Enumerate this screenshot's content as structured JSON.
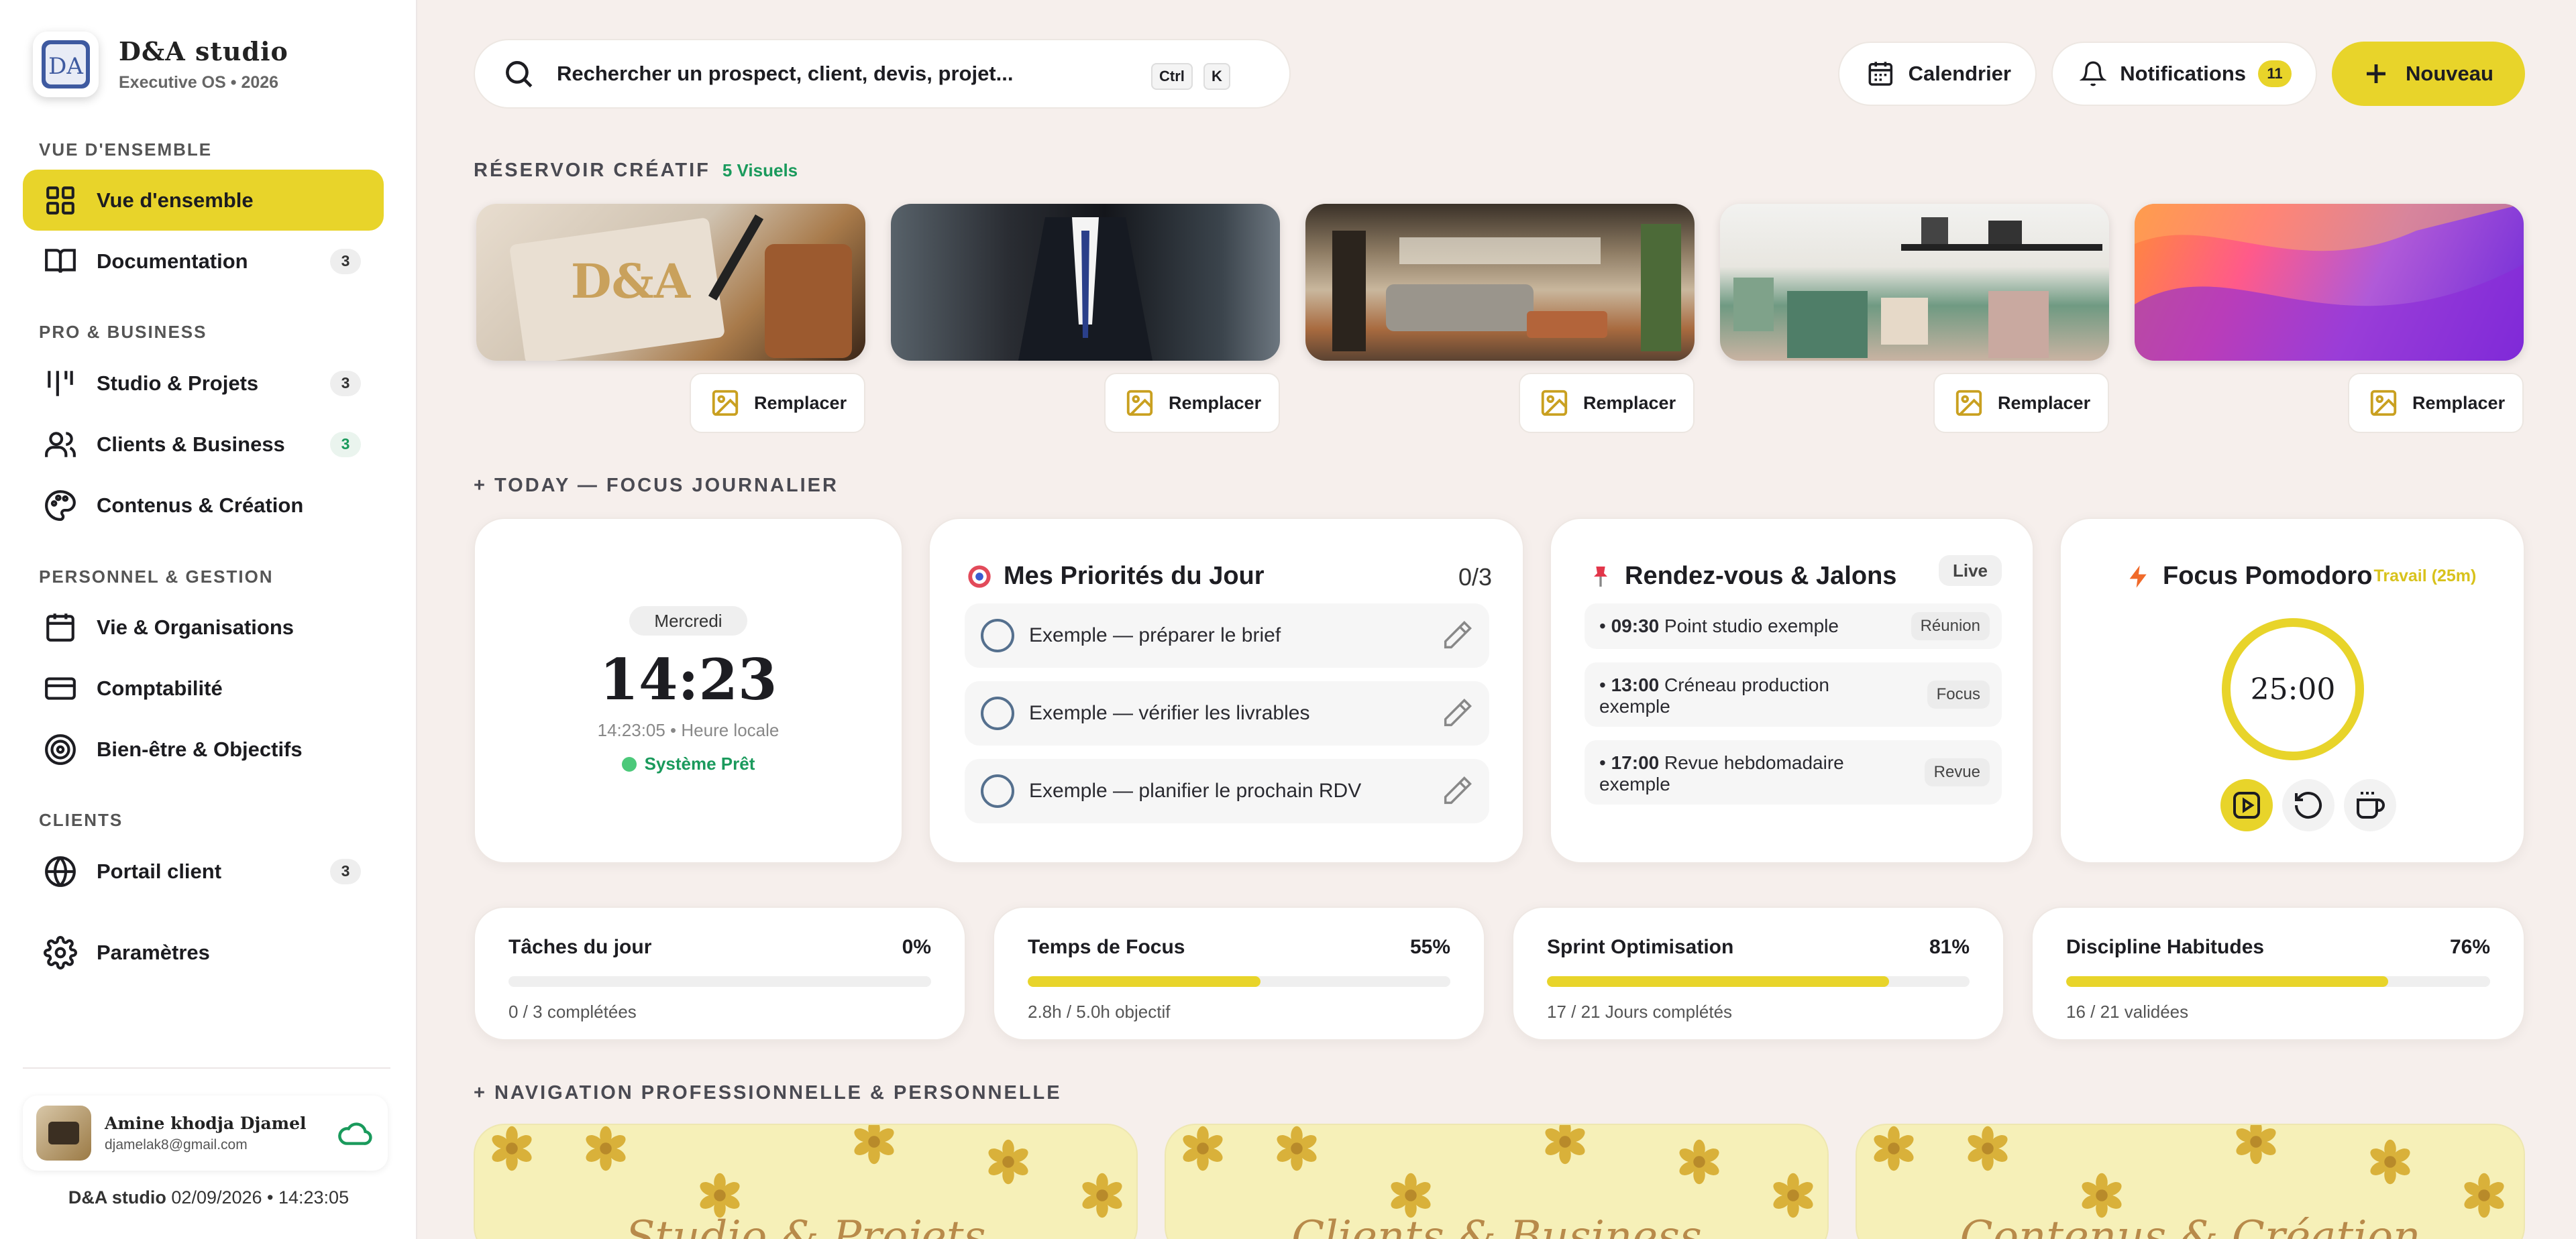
{
  "brand": {
    "name": "D&A studio",
    "subtitle": "Executive OS • 2026"
  },
  "sidebar": {
    "sections": [
      {
        "title": "VUE D'ENSEMBLE"
      },
      {
        "title": "PRO & BUSINESS"
      },
      {
        "title": "PERSONNEL & GESTION"
      },
      {
        "title": "CLIENTS"
      }
    ],
    "items": [
      {
        "label": "Vue d'ensemble",
        "icon": "grid-icon",
        "active": true
      },
      {
        "label": "Documentation",
        "icon": "book-icon",
        "badge": "3"
      },
      {
        "label": "Studio & Projets",
        "icon": "bars-icon",
        "badge": "3"
      },
      {
        "label": "Clients & Business",
        "icon": "users-icon",
        "badge": "3"
      },
      {
        "label": "Contenus & Création",
        "icon": "palette-icon"
      },
      {
        "label": "Vie & Organisations",
        "icon": "calendar-icon"
      },
      {
        "label": "Comptabilité",
        "icon": "card-icon"
      },
      {
        "label": "Bien-être & Objectifs",
        "icon": "target-icon"
      },
      {
        "label": "Portail client",
        "icon": "globe-icon",
        "badge": "3"
      },
      {
        "label": "Paramètres",
        "icon": "gear-icon"
      }
    ],
    "user": {
      "name": "Amine khodja Djamel",
      "email": "djamelak8@gmail.com"
    },
    "footer": {
      "app": "D&A studio",
      "datetime": "02/09/2026 • 14:23:05"
    }
  },
  "topbar": {
    "search_placeholder": "Rechercher un prospect, client, devis, projet...",
    "kbd_ctrl": "Ctrl",
    "kbd_k": "K",
    "calendar_label": "Calendrier",
    "notifications_label": "Notifications",
    "notifications_count": "11",
    "new_label": "Nouveau"
  },
  "reservoir": {
    "title": "RÉSERVOIR CRÉATIF",
    "count_label": "5 Visuels",
    "replace_label": "Remplacer"
  },
  "today": {
    "title": "+ TODAY — FOCUS JOURNALIER",
    "clock": {
      "day": "Mercredi",
      "time": "14:23",
      "time_full": "14:23:05 • Heure locale",
      "status": "Système Prêt"
    },
    "priorities": {
      "title": "Mes Priorités du Jour",
      "count": "0/3",
      "items": [
        "Exemple — préparer le brief",
        "Exemple — vérifier les livrables",
        "Exemple — planifier le prochain RDV"
      ]
    },
    "rdv": {
      "title": "Rendez-vous & Jalons",
      "chip": "Live",
      "items": [
        {
          "time": "09:30",
          "text": "Point studio exemple",
          "tag": "Réunion"
        },
        {
          "time": "13:00",
          "text": "Créneau production exemple",
          "tag": "Focus"
        },
        {
          "time": "17:00",
          "text": "Revue hebdomadaire exemple",
          "tag": "Revue"
        }
      ]
    },
    "pomodoro": {
      "title": "Focus Pomodoro",
      "mode": "Travail (25m)",
      "timer": "25:00"
    }
  },
  "stats": [
    {
      "title": "Tâches du jour",
      "pct_label": "0%",
      "pct": 0,
      "sub": "0 / 3 complétées"
    },
    {
      "title": "Temps de Focus",
      "pct_label": "55%",
      "pct": 55,
      "sub": "2.8h / 5.0h objectif"
    },
    {
      "title": "Sprint Optimisation",
      "pct_label": "81%",
      "pct": 81,
      "sub": "17 / 21 Jours complétés"
    },
    {
      "title": "Discipline Habitudes",
      "pct_label": "76%",
      "pct": 76,
      "sub": "16 / 21 validées"
    }
  ],
  "navigation": {
    "title": "+ NAVIGATION PROFESSIONNELLE & PERSONNELLE",
    "panels": [
      "Studio & Projets",
      "Clients & Business",
      "Contenus & Création"
    ]
  },
  "colors": {
    "accent": "#e8d42a",
    "success": "#1a9a5c"
  }
}
